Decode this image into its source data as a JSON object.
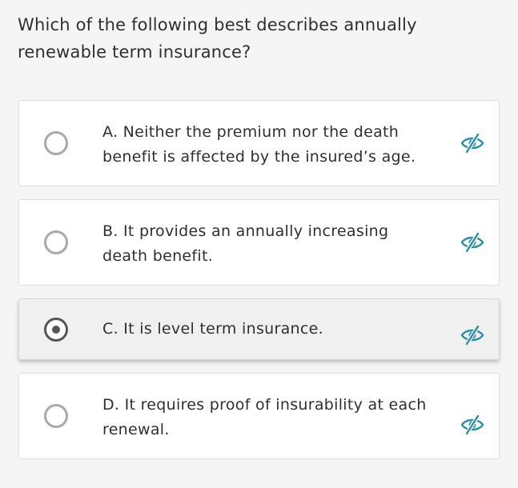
{
  "question": {
    "text": "Which of the following best describes annually renewable term insurance?"
  },
  "options": [
    {
      "label": "A. Neither the premium nor the death benefit is affected by the insured’s age.",
      "selected": false,
      "eliminate_icon": "eye-slash-icon"
    },
    {
      "label": "B. It provides an annually increasing death benefit.",
      "selected": false,
      "eliminate_icon": "eye-slash-icon"
    },
    {
      "label": "C. It is level term insurance.",
      "selected": true,
      "eliminate_icon": "eye-slash-icon"
    },
    {
      "label": "D. It requires proof of insurability at each renewal.",
      "selected": false,
      "eliminate_icon": "eye-slash-icon"
    }
  ],
  "colors": {
    "background": "#f5f5f5",
    "card": "#ffffff",
    "selected_card": "#f0f0f0",
    "radio_border": "#a9a9a9",
    "radio_selected": "#555555",
    "icon_accent": "#2a8fa5"
  }
}
